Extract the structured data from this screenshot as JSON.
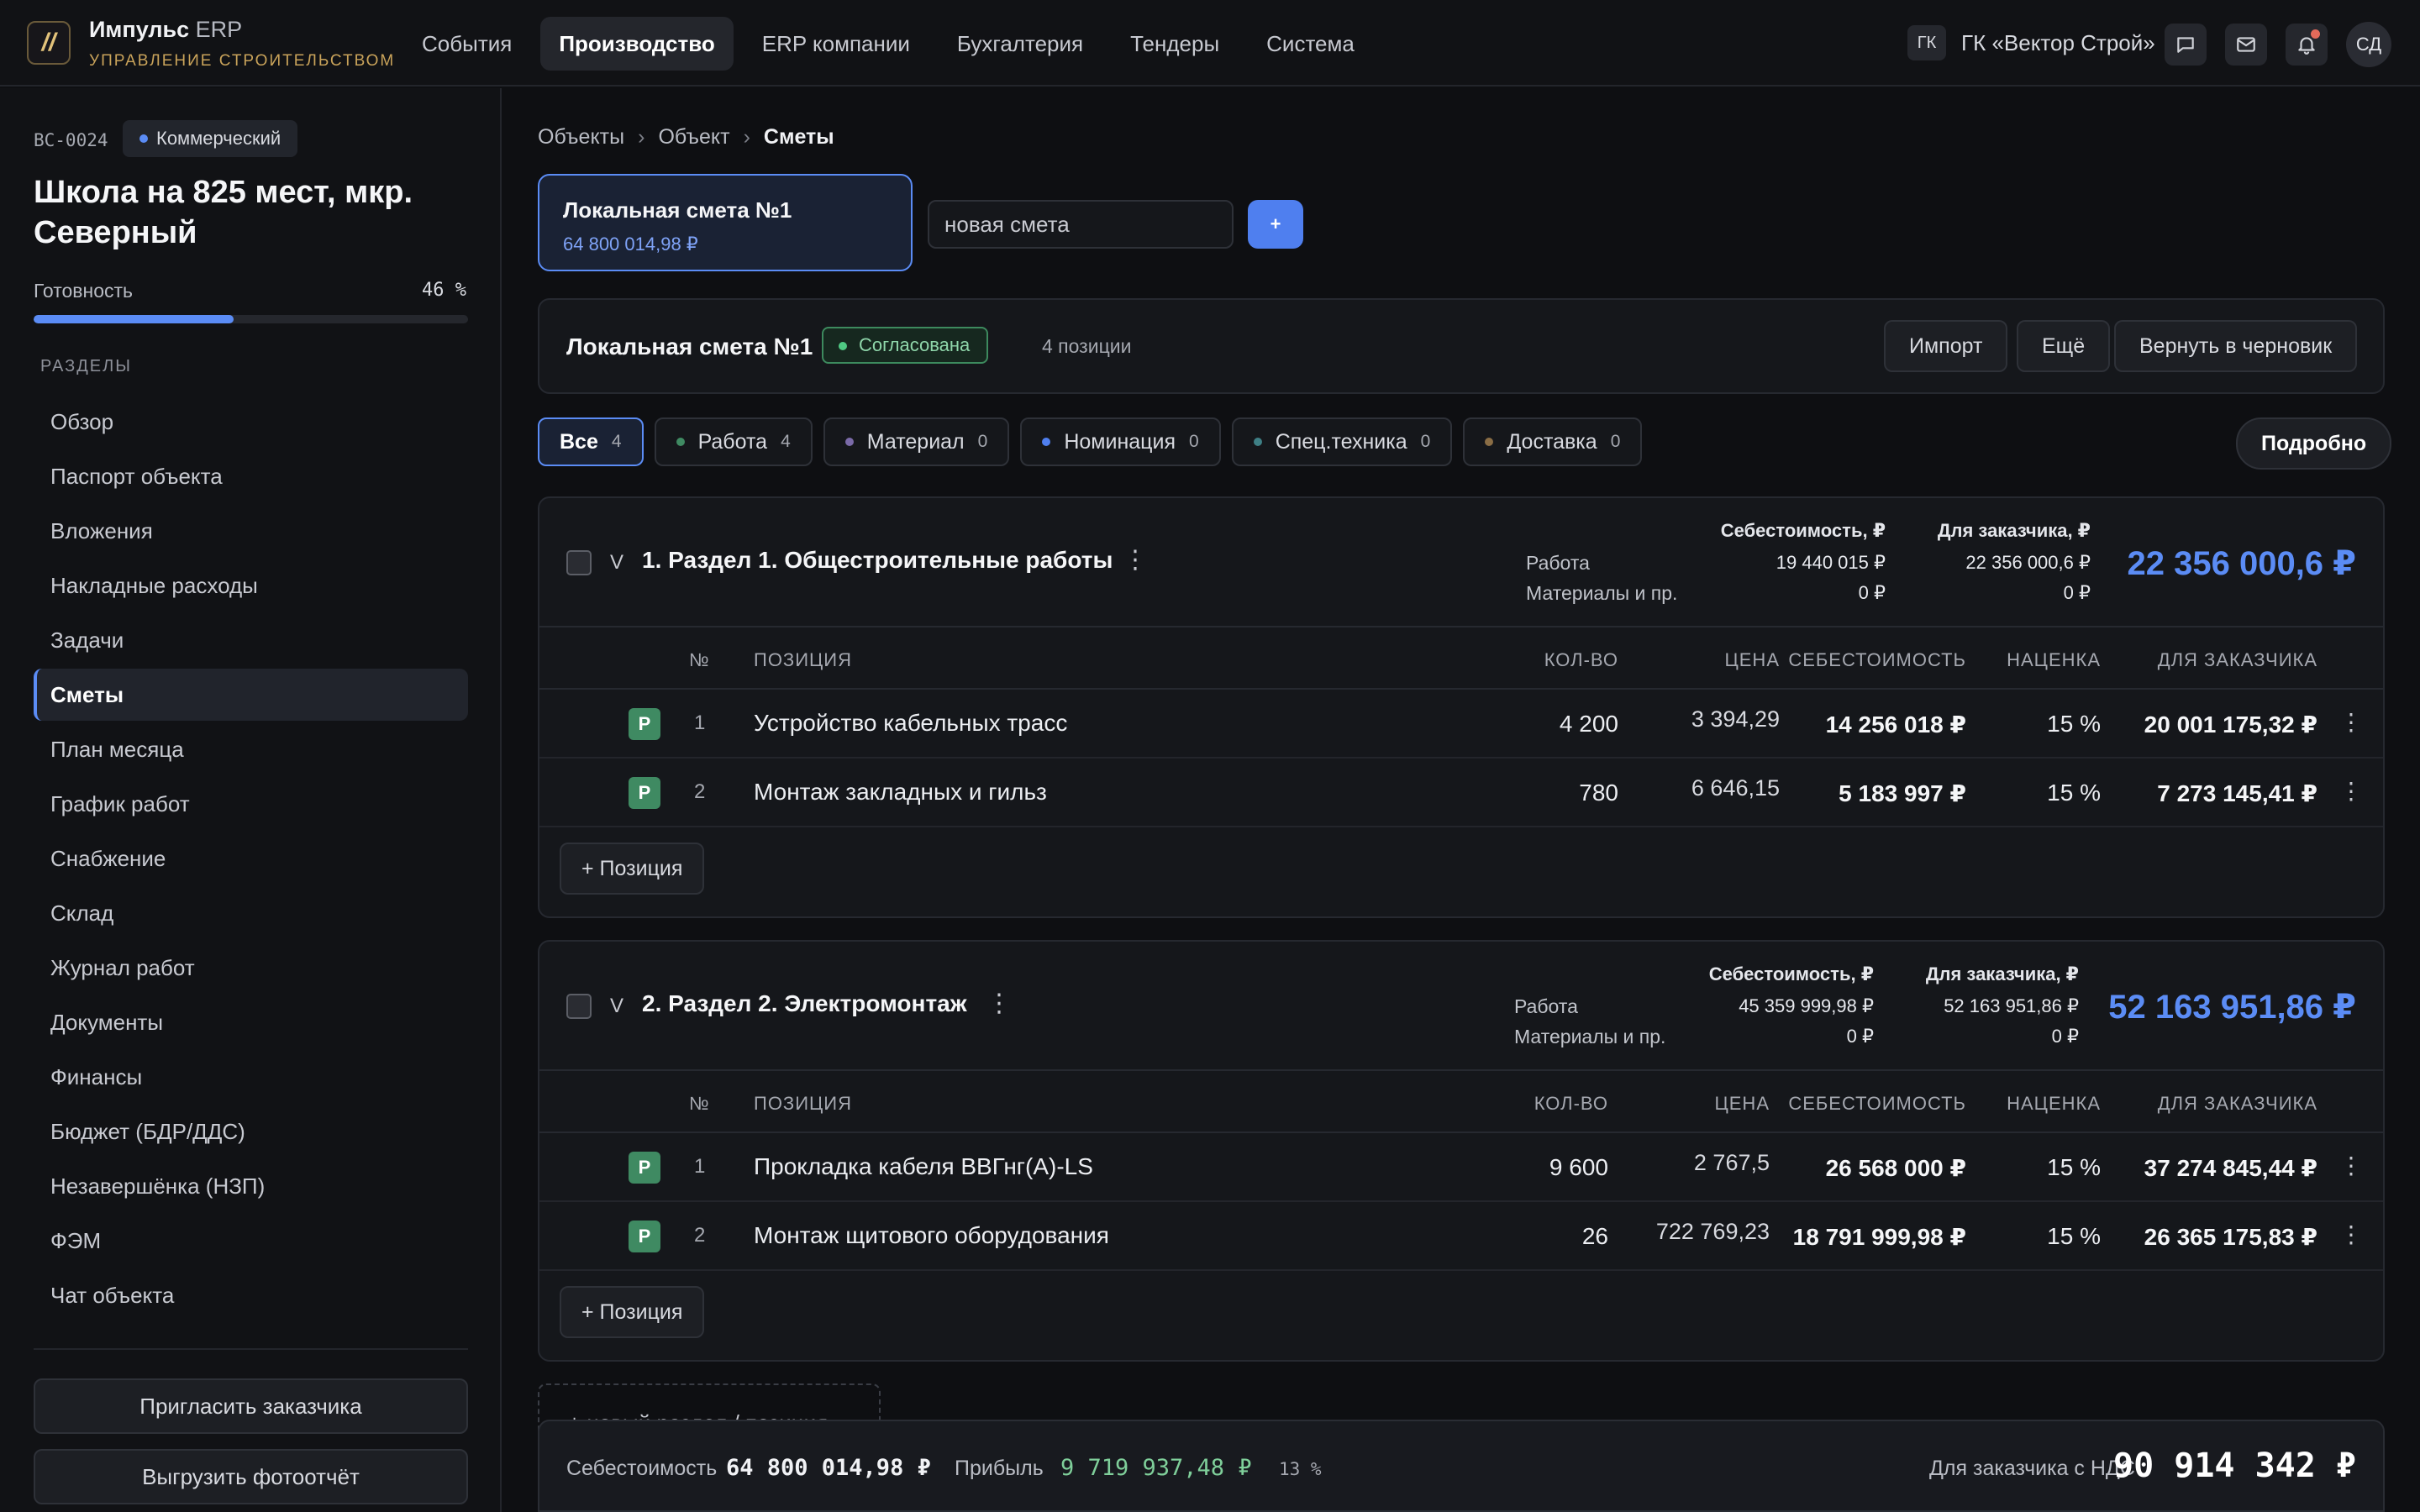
{
  "app": {
    "name": "Импульс",
    "name_suffix": "ERP",
    "subtitle": "УПРАВЛЕНИЕ СТРОИТЕЛЬСТВОМ",
    "logo": "//"
  },
  "nav": [
    "События",
    "Производство",
    "ERP компании",
    "Бухгалтерия",
    "Тендеры",
    "Система"
  ],
  "nav_active": "Производство",
  "company": {
    "badge": "ГК",
    "name": "ГК «Вектор Строй»"
  },
  "user": {
    "initials": "СД"
  },
  "top_icons": [
    "chat-icon",
    "mail-icon",
    "bell-icon"
  ],
  "object": {
    "code": "ВС-0024",
    "type": "Коммерческий",
    "title": "Школа на 825 мест, мкр. Северный",
    "readiness_label": "Готовность",
    "readiness_value": "46 %",
    "readiness_fraction": 0.46
  },
  "sidebar": {
    "sections_label": "РАЗДЕЛЫ",
    "items": [
      "Обзор",
      "Паспорт объекта",
      "Вложения",
      "Накладные расходы",
      "Задачи",
      "Сметы",
      "План месяца",
      "График работ",
      "Снабжение",
      "Склад",
      "Журнал работ",
      "Документы",
      "Финансы",
      "Бюджет (БДР/ДДС)",
      "Незавершёнка (НЗП)",
      "ФЭМ",
      "Чат объекта"
    ],
    "active": "Сметы",
    "invite_button": "Пригласить заказчика",
    "export_button": "Выгрузить фотоотчёт"
  },
  "breadcrumb": {
    "items": [
      "Объекты",
      "Объект",
      "Сметы"
    ],
    "separator": "›"
  },
  "estimate_tab": {
    "title": "Локальная смета №1",
    "sum": "64 800 014,98 ₽"
  },
  "new_estimate": {
    "placeholder": "новая смета",
    "add_label": "+"
  },
  "estimate_header": {
    "title": "Локальная смета №1",
    "status": "Согласована",
    "positions": "4 позиции",
    "buttons": {
      "import": "Импорт",
      "more": "Ещё",
      "revert": "Вернуть в черновик"
    }
  },
  "filters": [
    {
      "label": "Все",
      "count": "4",
      "color": ""
    },
    {
      "label": "Работа",
      "count": "4",
      "color": "#3f8a62"
    },
    {
      "label": "Материал",
      "count": "0",
      "color": "#7a6aa8"
    },
    {
      "label": "Номинация",
      "count": "0",
      "color": "#4f7fef"
    },
    {
      "label": "Спец.техника",
      "count": "0",
      "color": "#3e7f85"
    },
    {
      "label": "Доставка",
      "count": "0",
      "color": "#8a6d45"
    }
  ],
  "details_button": "Подробно",
  "columns": {
    "num": "№",
    "position": "ПОЗИЦИЯ",
    "qty": "КОЛ-ВО",
    "price": "ЦЕНА",
    "cost": "СЕБЕСТОИМОСТЬ",
    "markup": "НАЦЕНКА",
    "customer": "ДЛЯ ЗАКАЗЧИКА"
  },
  "totals_labels": {
    "cost": "Себестоимость, ₽",
    "customer": "Для заказчика, ₽",
    "work": "Работа",
    "materials": "Материалы и пр."
  },
  "sections": [
    {
      "title": "1. Раздел 1. Общестроительные работы",
      "chevron": "V",
      "work_cost": "19 440 015 ₽",
      "work_customer": "22 356 000,6 ₽",
      "mat_cost": "0 ₽",
      "mat_customer": "0 ₽",
      "total": "22 356 000,6 ₽",
      "add_position": "+ Позиция",
      "rows": [
        {
          "tag": "Р",
          "num": "1",
          "name": "Устройство кабельных трасс",
          "qty": "4 200",
          "price": "3 394,29",
          "cost": "14 256 018 ₽",
          "markup": "15 %",
          "customer": "20 001 175,32 ₽"
        },
        {
          "tag": "Р",
          "num": "2",
          "name": "Монтаж закладных и гильз",
          "qty": "780",
          "price": "6 646,15",
          "cost": "5 183 997 ₽",
          "markup": "15 %",
          "customer": "7 273 145,41 ₽"
        }
      ]
    },
    {
      "title": "2. Раздел 2. Электромонтаж",
      "chevron": "V",
      "work_cost": "45 359 999,98 ₽",
      "work_customer": "52 163 951,86 ₽",
      "mat_cost": "0 ₽",
      "mat_customer": "0 ₽",
      "total": "52 163 951,86 ₽",
      "add_position": "+ Позиция",
      "rows": [
        {
          "tag": "Р",
          "num": "1",
          "name": "Прокладка кабеля ВВГнг(А)-LS",
          "qty": "9 600",
          "price": "2 767,5",
          "cost": "26 568 000 ₽",
          "markup": "15 %",
          "customer": "37 274 845,44 ₽"
        },
        {
          "tag": "Р",
          "num": "2",
          "name": "Монтаж щитового оборудования",
          "qty": "26",
          "price": "722 769,23",
          "cost": "18 791 999,98 ₽",
          "markup": "15 %",
          "customer": "26 365 175,83 ₽"
        }
      ]
    }
  ],
  "new_section": "+ новый раздел / позиция",
  "footer": {
    "cost_label": "Себестоимость",
    "cost_value": "64 800 014,98 ₽",
    "profit_label": "Прибыль",
    "profit_value": "9 719 937,48 ₽",
    "profit_pct": "13 %",
    "customer_vat_label": "Для заказчика с НДС",
    "customer_vat_value": "90 914 342 ₽"
  }
}
